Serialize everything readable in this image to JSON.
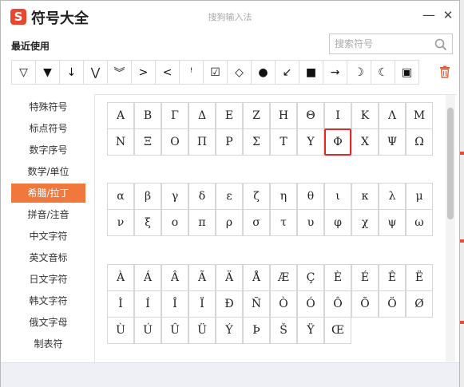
{
  "window": {
    "logo_glyph": "S",
    "app_title": "符号大全",
    "center_title": "搜狗输入法",
    "minimize_glyph": "—",
    "close_glyph": "✕"
  },
  "recent": {
    "label": "最近使用",
    "symbols": [
      "▽",
      "▼",
      "↓",
      "⋁",
      "︾",
      ">",
      "<",
      "ꜝ",
      "☑",
      "◇",
      "●",
      "↙",
      "■",
      "→",
      "☽",
      "☾",
      "▣"
    ]
  },
  "search": {
    "placeholder": "搜索符号",
    "value": ""
  },
  "sidebar": {
    "items": [
      {
        "label": "特殊符号"
      },
      {
        "label": "标点符号"
      },
      {
        "label": "数字序号"
      },
      {
        "label": "数学/单位"
      },
      {
        "label": "希腊/拉丁"
      },
      {
        "label": "拼音/注音"
      },
      {
        "label": "中文字符"
      },
      {
        "label": "英文音标"
      },
      {
        "label": "日文字符"
      },
      {
        "label": "韩文字符"
      },
      {
        "label": "俄文字母"
      },
      {
        "label": "制表符"
      }
    ],
    "active_index": 4
  },
  "groups": [
    {
      "rows": [
        [
          "Α",
          "Β",
          "Γ",
          "Δ",
          "Ε",
          "Ζ",
          "Η",
          "Θ",
          "Ι",
          "Κ",
          "Λ",
          "Μ"
        ],
        [
          "Ν",
          "Ξ",
          "Ο",
          "Π",
          "Ρ",
          "Σ",
          "Τ",
          "Υ",
          "Φ",
          "Χ",
          "Ψ",
          "Ω"
        ]
      ]
    },
    {
      "rows": [
        [
          "α",
          "β",
          "γ",
          "δ",
          "ε",
          "ζ",
          "η",
          "θ",
          "ι",
          "κ",
          "λ",
          "μ"
        ],
        [
          "ν",
          "ξ",
          "ο",
          "π",
          "ρ",
          "σ",
          "τ",
          "υ",
          "φ",
          "χ",
          "ψ",
          "ω"
        ]
      ]
    },
    {
      "rows": [
        [
          "À",
          "Á",
          "Â",
          "Ã",
          "Ä",
          "Å",
          "Æ",
          "Ç",
          "È",
          "É",
          "Ê",
          "Ë"
        ],
        [
          "Ì",
          "Í",
          "Î",
          "Ï",
          "Ð",
          "Ñ",
          "Ò",
          "Ó",
          "Ô",
          "Õ",
          "Ö",
          "Ø"
        ],
        [
          "Ù",
          "Ú",
          "Û",
          "Ü",
          "Ý",
          "Þ",
          "Š",
          "Ÿ",
          "Œ"
        ]
      ]
    }
  ],
  "selected_symbol": "Φ",
  "colors": {
    "accent": "#f0783c",
    "brand": "#e8462f",
    "selection_border": "#e02a2a"
  }
}
